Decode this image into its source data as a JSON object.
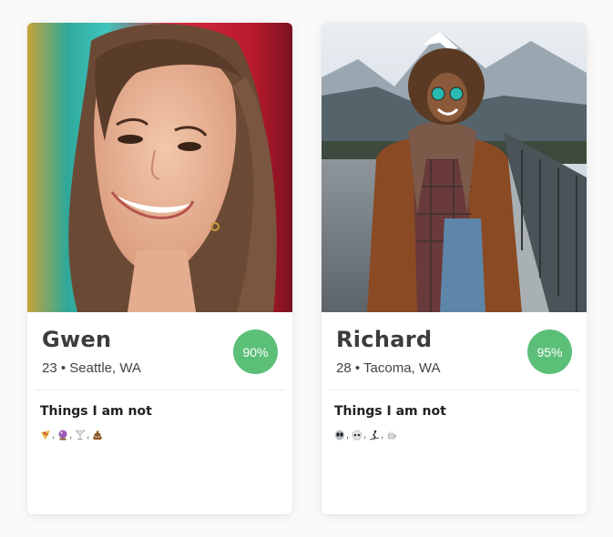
{
  "colors": {
    "match_badge": "#5cbf78",
    "card_bg": "#ffffff",
    "page_bg": "#fafafa"
  },
  "profiles": [
    {
      "name": "Gwen",
      "age": "23",
      "bullet": "•",
      "location": "Seattle, WA",
      "match": "90%",
      "section_title": "Things I am not",
      "not_icons": [
        "pizza-slice-emoji",
        "crystal-ball-emoji",
        "cocktail-glass-emoji",
        "pile-of-poo-emoji"
      ],
      "separator": ","
    },
    {
      "name": "Richard",
      "age": "28",
      "bullet": "•",
      "location": "Tacoma, WA",
      "match": "95%",
      "section_title": "Things I am not",
      "not_icons": [
        "alien-emoji",
        "skull-emoji",
        "skier-emoji",
        "hot-beverage-emoji"
      ],
      "separator": ","
    }
  ]
}
